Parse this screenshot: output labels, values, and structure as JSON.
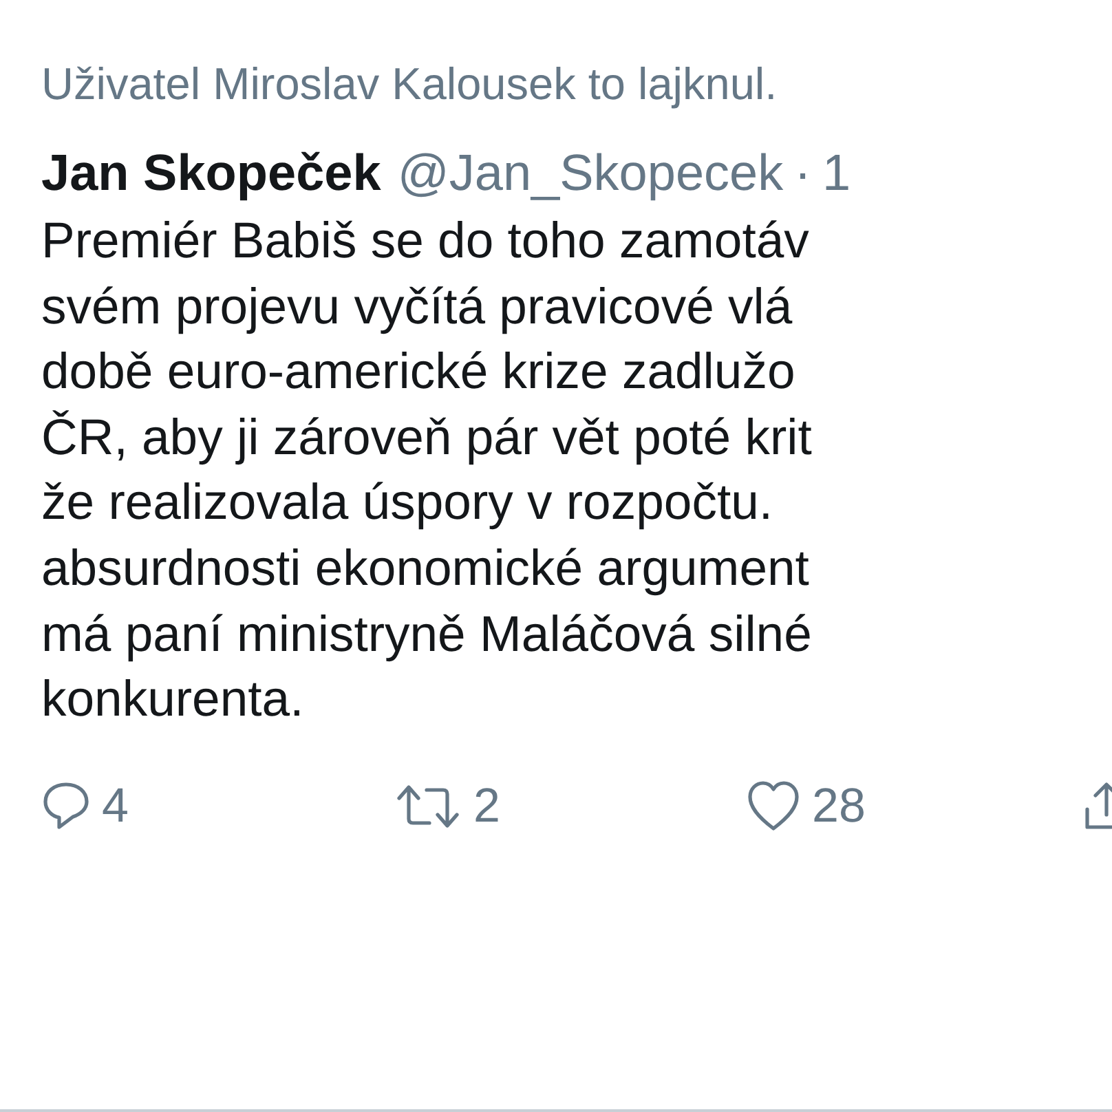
{
  "social_context": "Uživatel Miroslav Kalousek to lajknul.",
  "tweet": {
    "author_name": "Jan Skopeček",
    "handle": "@Jan_Skopecek",
    "separator": "·",
    "time": "1",
    "text_lines": [
      "Premiér Babiš se do toho zamotáv",
      "svém projevu vyčítá pravicové vlá",
      "době euro-americké krize zadlužo",
      "ČR, aby ji zároveň pár vět poté krit",
      "že realizovala úspory v rozpočtu.",
      "absurdnosti ekonomické argument",
      "má paní ministryně Maláčová silné",
      "konkurenta."
    ],
    "actions": [
      {
        "kind": "reply",
        "count": "4"
      },
      {
        "kind": "retweet",
        "count": "2"
      },
      {
        "kind": "like",
        "count": "28"
      },
      {
        "kind": "share"
      }
    ]
  }
}
